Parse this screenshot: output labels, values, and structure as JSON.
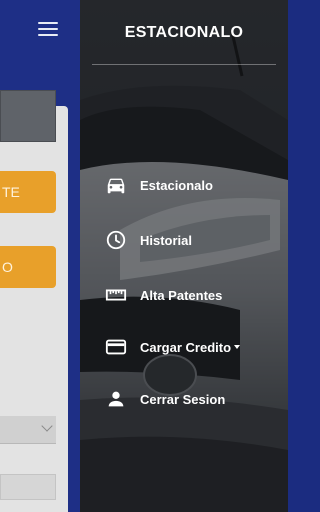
{
  "drawer": {
    "title": "ESTACIONALO",
    "items": [
      {
        "label": "Estacionalo",
        "icon": "car-icon"
      },
      {
        "label": "Historial",
        "icon": "clock-icon"
      },
      {
        "label": "Alta Patentes",
        "icon": "ruler-icon"
      },
      {
        "label": "Cargar Credito",
        "icon": "credit-card-icon",
        "has_dropdown": true
      },
      {
        "label": "Cerrar Sesion",
        "icon": "person-icon"
      }
    ]
  },
  "background_page": {
    "button_1_fragment": "TE",
    "button_2_fragment": "O"
  },
  "colors": {
    "header_blue": "#1e2f86",
    "button_orange": "#e8a02a",
    "drawer_text": "#ffffff"
  }
}
